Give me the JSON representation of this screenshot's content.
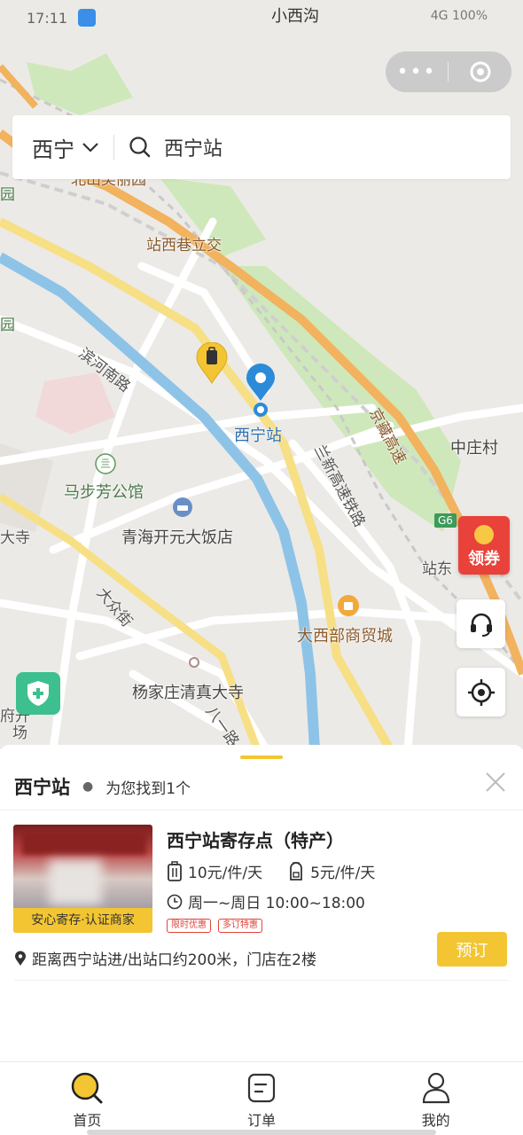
{
  "status_bar": {
    "time": "17:11",
    "center_label": "小西沟",
    "right_text": "4G 100%"
  },
  "capsule": {
    "more_label": "•••"
  },
  "search": {
    "city": "西宁",
    "query": "西宁站"
  },
  "map": {
    "labels": {
      "park_top": "北山美丽园",
      "zhanxi": "站西巷立交",
      "binhe": "滨河南路",
      "xining_station": "西宁站",
      "mabufang": "马步芳公馆",
      "qinghai_hotel": "青海开元大饭店",
      "dazhong": "大众街",
      "yangjiazhuang": "杨家庄清真大寺",
      "dabuxi": "大西部商贸城",
      "zhongzhuang": "中庄村",
      "zhandong": "站东",
      "jingzang": "京藏高速",
      "lanxin": "兰新高速铁路",
      "g6": "G6",
      "yuan1": "园",
      "yuan2": "园",
      "si": "大寺",
      "fukai": "府开",
      "chang": "场",
      "bayi": "八一路"
    },
    "coupon_label": "领券"
  },
  "sheet": {
    "title": "西宁站",
    "found_text": "为您找到1个",
    "shop": {
      "name": "西宁站寄存点（特产）",
      "badge": "安心寄存·认证商家",
      "price_large": "10元/件/天",
      "price_small": "5元/件/天",
      "hours": "周一~周日 10:00~18:00",
      "tags": [
        "限时优惠",
        "多订特惠"
      ],
      "distance": "距离西宁站进/出站口约200米，门店在2楼",
      "book_label": "预订"
    }
  },
  "tabs": [
    {
      "label": "首页",
      "icon": "search-home-icon"
    },
    {
      "label": "订单",
      "icon": "order-icon"
    },
    {
      "label": "我的",
      "icon": "user-icon"
    }
  ],
  "colors": {
    "accent": "#F3C532",
    "map_bg": "#ECEAE6",
    "road_highway": "#F2B25E",
    "river": "#8EC3E8",
    "green": "#CDE9B8",
    "marker_blue": "#2B8BD8",
    "coupon_red": "#E8423A"
  }
}
